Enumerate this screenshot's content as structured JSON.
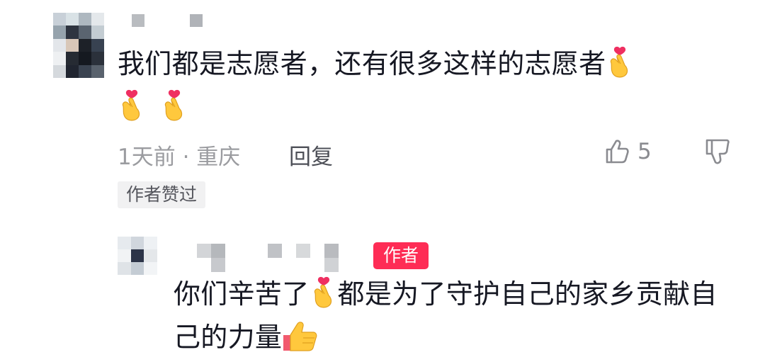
{
  "comment": {
    "text_part1": "我们都是志愿者，还有很多这样的志愿者",
    "emoji_icon": "finger-heart-emoji",
    "time_location": "1天前 · 重庆",
    "reply_label": "回复",
    "like_count": "5",
    "author_liked_tag": "作者赞过"
  },
  "reply": {
    "author_badge": "作者",
    "text_part1": "你们辛苦了",
    "text_part2": "都是为了守护自己的家乡贡献自己的力量",
    "emoji_icons": [
      "finger-heart-emoji",
      "thumbs-up-emoji"
    ]
  },
  "colors": {
    "text": "#161823",
    "meta": "#9b9ca0",
    "badge": "#fe2c55",
    "tag_bg": "#f1f1f2"
  }
}
